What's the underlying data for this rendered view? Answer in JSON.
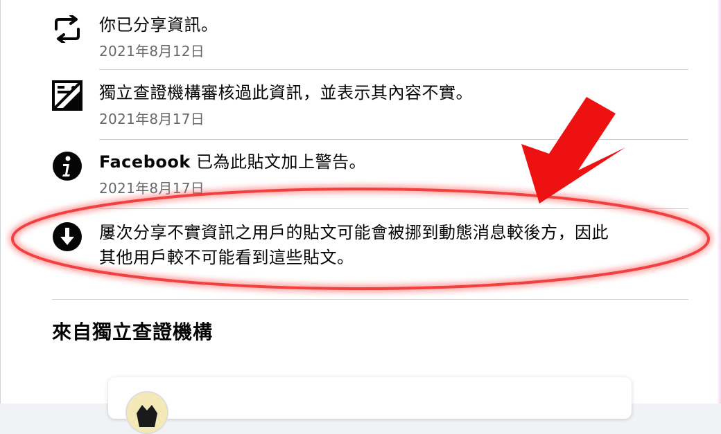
{
  "events": [
    {
      "icon": "share-repost-icon",
      "text": "你已分享資訊。",
      "date": "2021年8月12日"
    },
    {
      "icon": "false-info-image-icon",
      "text": "獨立查證機構審核過此資訊，並表示其內容不實。",
      "date": "2021年8月17日"
    },
    {
      "icon": "info-icon",
      "brand": "Facebook",
      "text": " 已為此貼文加上警告。",
      "date": "2021年8月17日"
    },
    {
      "icon": "down-arrow-icon",
      "line1": "屢次分享不實資訊之用戶的貼文可能會被挪到動態消息較後方，因此",
      "line2": "其他用戶較不可能看到這些貼文。"
    }
  ],
  "section_title": "來自獨立查證機構",
  "colors": {
    "text": "#050505",
    "secondary_text": "#65676b",
    "divider": "#ced0d4",
    "annotation_red": "#ee1111"
  }
}
